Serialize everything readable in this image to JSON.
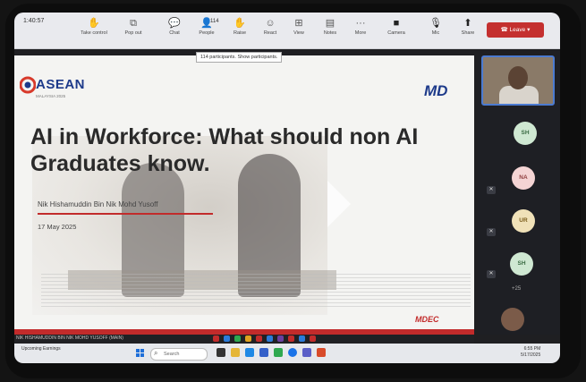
{
  "toolbar": {
    "timer": "1:40:57",
    "buttons": [
      {
        "label": "Take control"
      },
      {
        "label": "Pop out"
      },
      {
        "label": "Chat"
      },
      {
        "label": "People",
        "count": "114"
      },
      {
        "label": "Raise"
      },
      {
        "label": "React"
      },
      {
        "label": "View"
      },
      {
        "label": "Notes"
      },
      {
        "label": "More"
      },
      {
        "label": "Camera"
      },
      {
        "label": "Mic"
      },
      {
        "label": "Share"
      }
    ],
    "leave_label": "Leave",
    "tooltip": "114 participants. Show participants."
  },
  "slide": {
    "logo_left": "ASEAN",
    "logo_left_sub": "MALAYSIA 2025",
    "logo_right": "MD",
    "title": "AI in Workforce: What should non AI Graduates know.",
    "presenter": "Nik Hishamuddin Bin Nik Mohd Yusoff",
    "date": "17 May 2025",
    "footer_logo": "MDEC"
  },
  "participants": {
    "avatars": [
      "SH",
      "NA",
      "UR",
      "SH"
    ],
    "more_label": "+25"
  },
  "status_bar": {
    "name": "NIK HISHAMUDDIN BIN NIK MOHD YUSOFF (MAIN)"
  },
  "taskbar": {
    "weather": "Upcoming Earnings",
    "search_placeholder": "Search",
    "time": "6:55 PM",
    "date": "5/17/2025"
  }
}
